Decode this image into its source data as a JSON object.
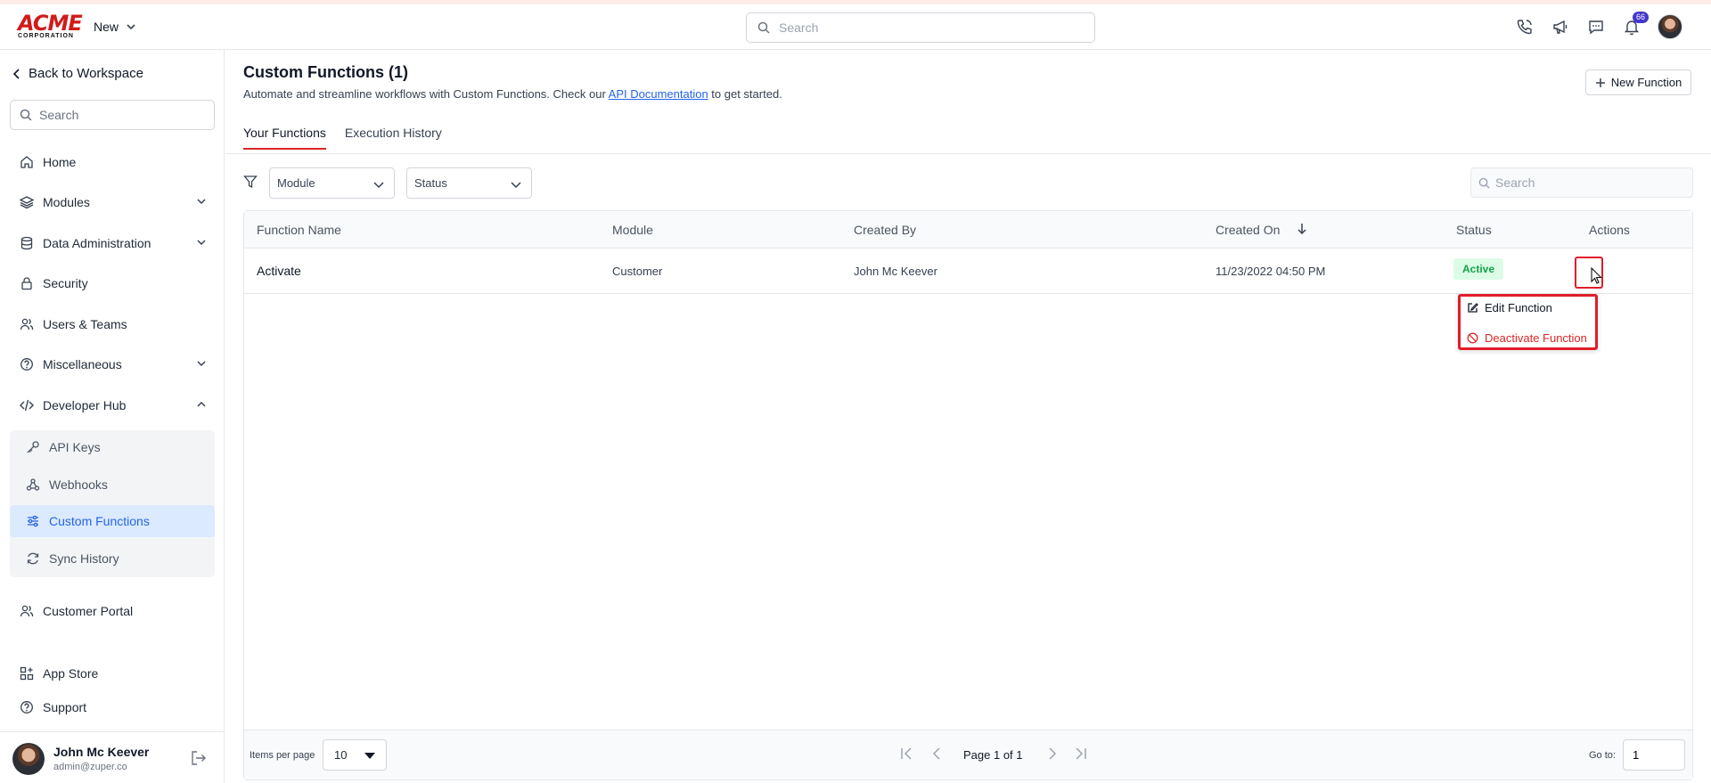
{
  "header": {
    "logo_text": "ACME",
    "logo_sub": "CORPORATION",
    "new_label": "New",
    "search_placeholder": "Search",
    "notification_count": "66",
    "icons": [
      "phone-icon",
      "megaphone-icon",
      "chat-icon",
      "bell-icon"
    ]
  },
  "sidebar": {
    "back_label": "Back to Workspace",
    "search_placeholder": "Search",
    "items": [
      {
        "label": "Home",
        "icon": "home-icon"
      },
      {
        "label": "Modules",
        "icon": "layers-icon"
      },
      {
        "label": "Data Administration",
        "icon": "database-icon"
      },
      {
        "label": "Security",
        "icon": "lock-icon"
      },
      {
        "label": "Users & Teams",
        "icon": "users-icon"
      },
      {
        "label": "Miscellaneous",
        "icon": "help-circle-icon"
      },
      {
        "label": "Developer Hub",
        "icon": "code-icon"
      }
    ],
    "sub_items": [
      {
        "label": "API Keys",
        "icon": "key-icon"
      },
      {
        "label": "Webhooks",
        "icon": "webhook-icon"
      },
      {
        "label": "Custom Functions",
        "icon": "sliders-icon"
      },
      {
        "label": "Sync History",
        "icon": "refresh-icon"
      }
    ],
    "bottom_items": [
      {
        "label": "Customer Portal",
        "icon": "user-group-icon"
      },
      {
        "label": "App Store",
        "icon": "grid-plus-icon"
      },
      {
        "label": "Support",
        "icon": "help-circle-icon"
      }
    ],
    "user": {
      "name": "John Mc Keever",
      "email": "admin@zuper.co"
    }
  },
  "main": {
    "title": "Custom Functions (1)",
    "desc_before": "Automate and streamline workflows with Custom Functions. Check our ",
    "desc_link": "API Documentation",
    "desc_after": " to get started.",
    "new_button": "New Function",
    "tabs": [
      {
        "label": "Your Functions",
        "active": true
      },
      {
        "label": "Execution History",
        "active": false
      }
    ],
    "filters": {
      "module": "Module",
      "status": "Status",
      "search_placeholder": "Search"
    },
    "columns": [
      "Function Name",
      "Module",
      "Created By",
      "Created On",
      "Status",
      "Actions"
    ],
    "rows": [
      {
        "name": "Activate",
        "module": "Customer",
        "created_by": "John Mc Keever",
        "created_on": "11/23/2022 04:50 PM",
        "status": "Active"
      }
    ],
    "menu": {
      "edit": "Edit Function",
      "deactivate": "Deactivate Function"
    },
    "pagination": {
      "items_label": "Items per page",
      "items_value": "10",
      "page_info": "Page 1 of 1",
      "goto_label": "Go to:",
      "goto_value": "1"
    }
  },
  "colors": {
    "accent": "#dc2626",
    "link": "#2563eb",
    "active_bg": "#dbeafe",
    "status_green": "#16a34a"
  }
}
